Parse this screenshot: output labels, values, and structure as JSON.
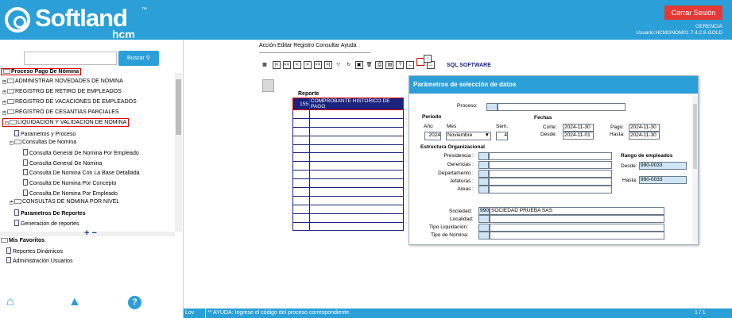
{
  "header": {
    "logo_text": "Softland",
    "logo_tm": "™",
    "logo_sub": "hcm",
    "logout_label": "Cerrar Sesión",
    "role": "GERENCIA",
    "user": "Usuario:HCMGNOM01 7.4.2.9-GOLD"
  },
  "search": {
    "placeholder": "",
    "button_label": "Buscar"
  },
  "tree": {
    "root": "Proceso Pago De Nómina",
    "items": [
      "ADMINISTRAR NOVEDADES DE NOMINA",
      "REGISTRO DE RETIRO DE EMPLEADOS",
      "REGISTRO DE VACACIONES DE EMPLEADOS",
      "REGISTRO DE CESANTIAS PARCIALES",
      "LIQUIDACIÓN Y VALIDACIÓN DE NÓMINA"
    ],
    "sub_items": [
      "Parametros y Proceso",
      "Consultas De Nomina"
    ],
    "consultas": [
      "Consulta General De Nomina Por Empleado",
      "Consulta General De Nomina",
      "Consulta De Nomina Con La Base Detallada",
      "Consulta De Nomina Por Concepto",
      "Consulta De Nomina Por Empleado"
    ],
    "after": [
      "CONSULTAS DE NOMINA POR NIVEL",
      "Parametros De Reportes",
      "Generación de reportes"
    ],
    "plusminus": "+ −",
    "favoritos": "Mis Favoritos",
    "fav_items": [
      "Reportes Dinámicos",
      "Administración Usuarios"
    ]
  },
  "menubar": [
    "Acción",
    "Editar",
    "Registro",
    "Consultar",
    "Ayuda"
  ],
  "toolbar_title": "SQL SOFTWARE",
  "report": {
    "label": "Reporte",
    "code": "155",
    "name": "COMPROBANTE HISTORICO DE PAGO"
  },
  "dialog": {
    "title": "Parámetros de selección de datos",
    "proceso_label": "Proceso:",
    "periodo_label": "Periodo",
    "anio_label": "Año",
    "mes_label": "Mes",
    "sem_label": "Sem.",
    "anio": "2024",
    "mes": "Noviembre",
    "sem": "4",
    "fechas_label": "Fechas",
    "corte_label": "Corte:",
    "desde_label": "Desde:",
    "pago_label": "Pago:",
    "hasta_label": "Hasta:",
    "corte": "2024-11-30",
    "desde": "2024-11-01",
    "pago": "2024-11-30",
    "hasta": "2024-11-30",
    "estructura_label": "Estructura Organizacional",
    "org": [
      "Presidencia",
      "Gerencias",
      "Departamento",
      "Jefaturas",
      "Areas"
    ],
    "rango_label": "Rango de empleados",
    "rango_desde_label": "Desde:",
    "rango_hasta_label": "Hasta:",
    "rango_desde": "990-0033",
    "rango_hasta": "990-0033",
    "sociedad_label": "Sociedad:",
    "sociedad_code": "990",
    "sociedad_name": "SOCIEDAD  PRUEBA SAS",
    "localidad_label": "Localidad:",
    "tipo_liq_label": "Tipo Liquidación:",
    "tipo_nom_label": "Tipo de Nómina:"
  },
  "status": {
    "mode": "Lov",
    "message": "** AYUDA: Ingrese el código del proceso correspondiente.",
    "page": "1 / 1"
  },
  "colors": {
    "brand": "#2a9fd8",
    "logout": "#e53935",
    "highlight": "#d00000"
  }
}
